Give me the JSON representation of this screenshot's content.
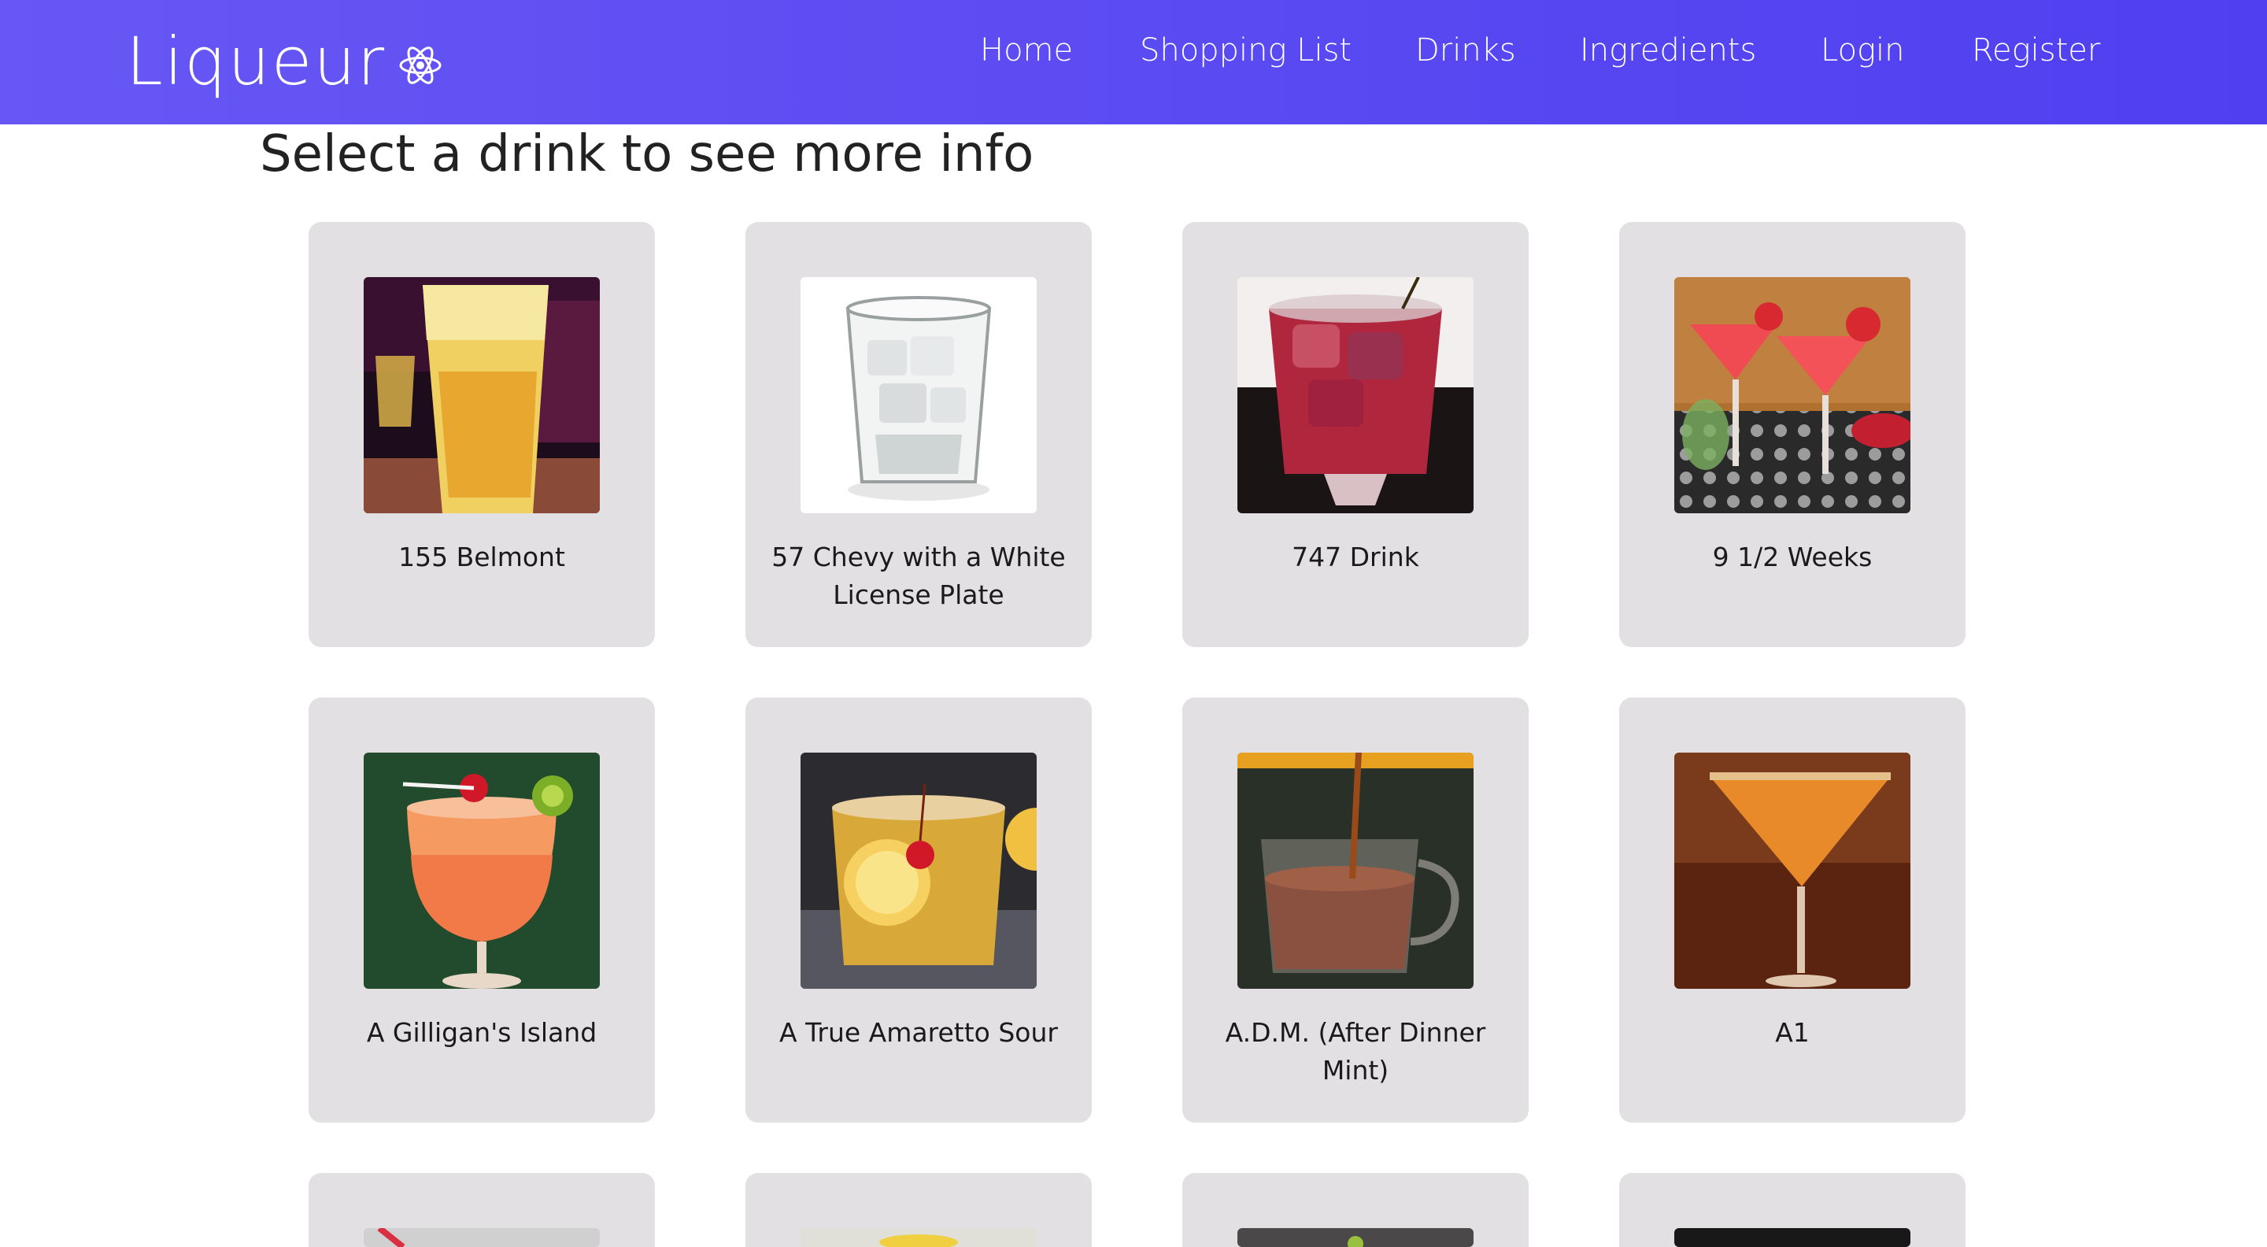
{
  "navbar": {
    "brand": "Liqueur",
    "links": [
      {
        "label": "Home"
      },
      {
        "label": "Shopping List"
      },
      {
        "label": "Drinks"
      },
      {
        "label": "Ingredients"
      },
      {
        "label": "Login"
      },
      {
        "label": "Register"
      }
    ]
  },
  "page": {
    "heading": "Select a drink to see more info"
  },
  "drinks": [
    {
      "name": "155 Belmont",
      "image": "tall-yellow-cocktail-photo"
    },
    {
      "name": "57 Chevy with a White License Plate",
      "image": "clear-rocks-glass-photo"
    },
    {
      "name": "747 Drink",
      "image": "red-iced-drink-photo"
    },
    {
      "name": "9 1/2 Weeks",
      "image": "pink-martini-strawberry-photo"
    },
    {
      "name": "A Gilligan's Island",
      "image": "orange-tropical-cocktail-photo"
    },
    {
      "name": "A True Amaretto Sour",
      "image": "amber-sour-with-lemon-photo"
    },
    {
      "name": "A.D.M. (After Dinner Mint)",
      "image": "hot-chocolate-mug-photo"
    },
    {
      "name": "A1",
      "image": "orange-martini-sugar-rim-photo"
    }
  ],
  "colors": {
    "navbar_start": "#6757f4",
    "navbar_end": "#4f3ff0",
    "card_background": "#e2e0e3"
  }
}
